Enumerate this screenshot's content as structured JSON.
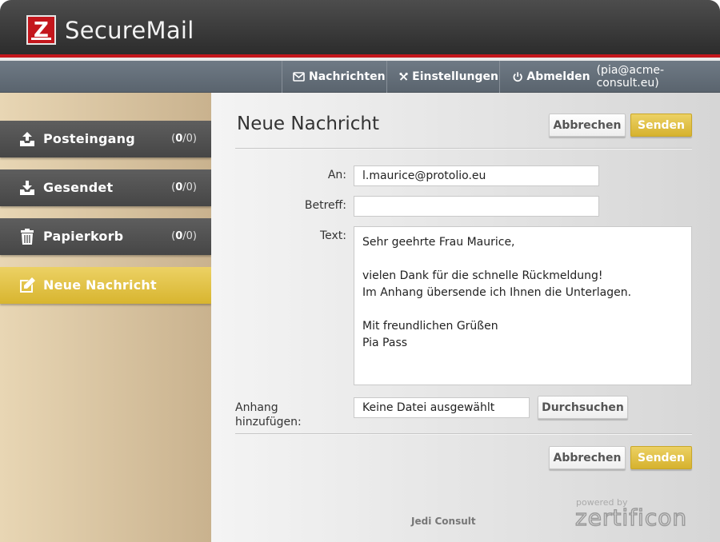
{
  "app": {
    "title": "SecureMail",
    "logo_letter": "Z"
  },
  "nav": {
    "messages": "Nachrichten",
    "settings": "Einstellungen",
    "logout": "Abmelden",
    "user": "(pia@acme-consult.eu)"
  },
  "sidebar": {
    "items": [
      {
        "label": "Posteingang",
        "unread": "0",
        "total": "0",
        "icon": "inbox-upload-icon"
      },
      {
        "label": "Gesendet",
        "unread": "0",
        "total": "0",
        "icon": "sent-download-icon"
      },
      {
        "label": "Papierkorb",
        "unread": "0",
        "total": "0",
        "icon": "trash-icon"
      },
      {
        "label": "Neue Nachricht",
        "icon": "compose-icon",
        "active": true
      }
    ]
  },
  "compose": {
    "title": "Neue Nachricht",
    "cancel_label": "Abbrechen",
    "send_label": "Senden",
    "to_label": "An:",
    "to_value": "l.maurice@protolio.eu",
    "subject_label": "Betreff:",
    "subject_value": "",
    "text_label": "Text:",
    "body_lines": [
      "Sehr geehrte Frau Maurice,",
      "",
      "vielen Dank für die schnelle Rückmeldung!",
      "Im Anhang übersende ich Ihnen die Unterlagen.",
      "",
      "Mit freundlichen Grüßen",
      "Pia Pass"
    ],
    "attachment_label": "Anhang hinzufügen:",
    "attachment_value": "Keine Datei ausgewählt",
    "browse_label": "Durchsuchen"
  },
  "footer": {
    "brand": "Jedi Consult",
    "powered_by": "powered by",
    "vendor": "zertificon"
  },
  "colors": {
    "accent_red": "#c4161c",
    "accent_gold": "#d8b52f",
    "nav_bg": "#66707a"
  }
}
